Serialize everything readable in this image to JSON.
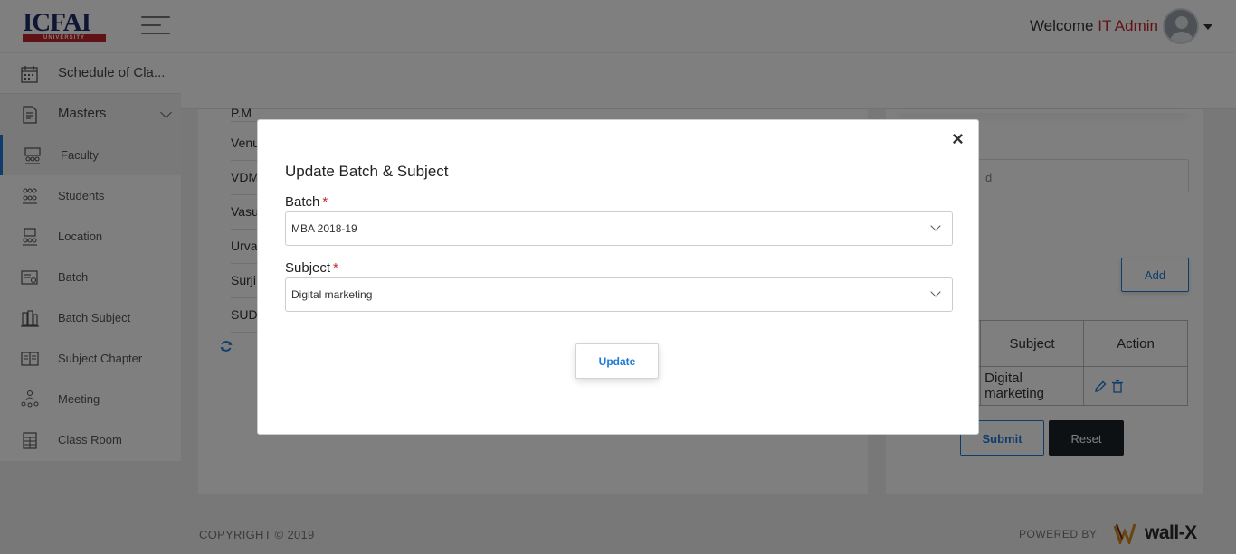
{
  "header": {
    "logo_text": "ICFAI",
    "logo_subtext": "UNIVERSITY",
    "welcome_text": "Welcome",
    "user_name": "IT Admin"
  },
  "sidebar": {
    "schedule_label": "Schedule of Cla...",
    "masters_label": "Masters",
    "items": [
      {
        "label": "Faculty",
        "icon": "faculty-icon",
        "active": true
      },
      {
        "label": "Students",
        "icon": "students-icon"
      },
      {
        "label": "Location",
        "icon": "location-icon"
      },
      {
        "label": "Batch",
        "icon": "batch-icon"
      },
      {
        "label": "Batch Subject",
        "icon": "batch-subject-icon"
      },
      {
        "label": "Subject Chapter",
        "icon": "subject-chapter-icon"
      },
      {
        "label": "Meeting",
        "icon": "meeting-icon"
      },
      {
        "label": "Class Room",
        "icon": "class-room-icon"
      }
    ]
  },
  "left_list": {
    "rows": [
      "P.M",
      "Venu",
      "VDM",
      "Vasu",
      "Urva",
      "Surji",
      "SUD"
    ]
  },
  "right_panel": {
    "input_partial": "d",
    "add_label": "Add",
    "table": {
      "headers": [
        "Subject",
        "Action"
      ],
      "row_subject": "Digital marketing",
      "row_dash": "-"
    },
    "submit_label": "Submit",
    "reset_label": "Reset"
  },
  "footer": {
    "copyright": "COPYRIGHT © 2019",
    "powered_by": "POWERED BY",
    "brand": "wall-X"
  },
  "modal": {
    "close": "×",
    "title": "Update Batch & Subject",
    "batch_label": "Batch",
    "batch_value": "MBA 2018-19",
    "subject_label": "Subject",
    "subject_value": "Digital marketing",
    "required_mark": "*",
    "update_label": "Update"
  },
  "colors": {
    "accent": "#1e7ad6",
    "brand_red": "#c1272d",
    "overlay": "rgba(0,0,0,0.5)"
  }
}
